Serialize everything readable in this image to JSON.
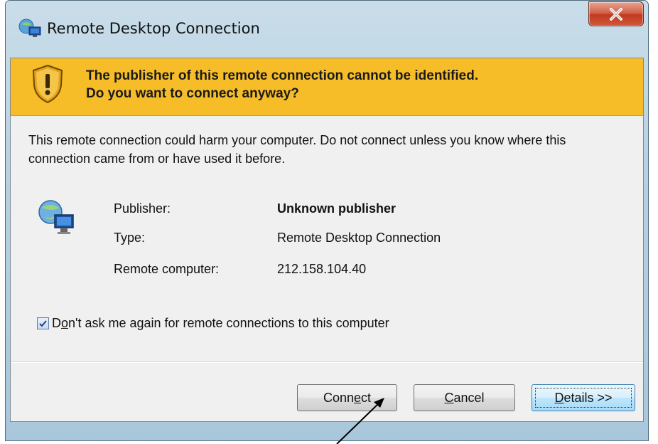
{
  "window": {
    "title": "Remote Desktop Connection",
    "close_glyph": "X"
  },
  "banner": {
    "line1": "The publisher of this remote connection cannot be identified.",
    "line2": "Do you want to connect anyway?",
    "icon": "warning-shield-icon",
    "color": "#f6bd29"
  },
  "warning_text": "This remote connection could harm your computer. Do not connect unless you know where this connection came from or have used it before.",
  "details": {
    "icon": "remote-computer-icon",
    "rows": [
      {
        "label": "Publisher:",
        "value": "Unknown publisher"
      },
      {
        "label": "Type:",
        "value": "Remote Desktop Connection"
      },
      {
        "label": "Remote computer:",
        "value": "212.158.104.40"
      }
    ]
  },
  "checkbox": {
    "checked": true,
    "label_pre": "D",
    "label_u": "o",
    "label_post": "n't ask me again for remote connections to this computer"
  },
  "buttons": {
    "connect": {
      "pre": "Conn",
      "u": "e",
      "post": "ct"
    },
    "cancel": {
      "pre": "",
      "u": "C",
      "post": "ancel"
    },
    "details": {
      "pre": "",
      "u": "D",
      "post": "etails >>"
    }
  }
}
